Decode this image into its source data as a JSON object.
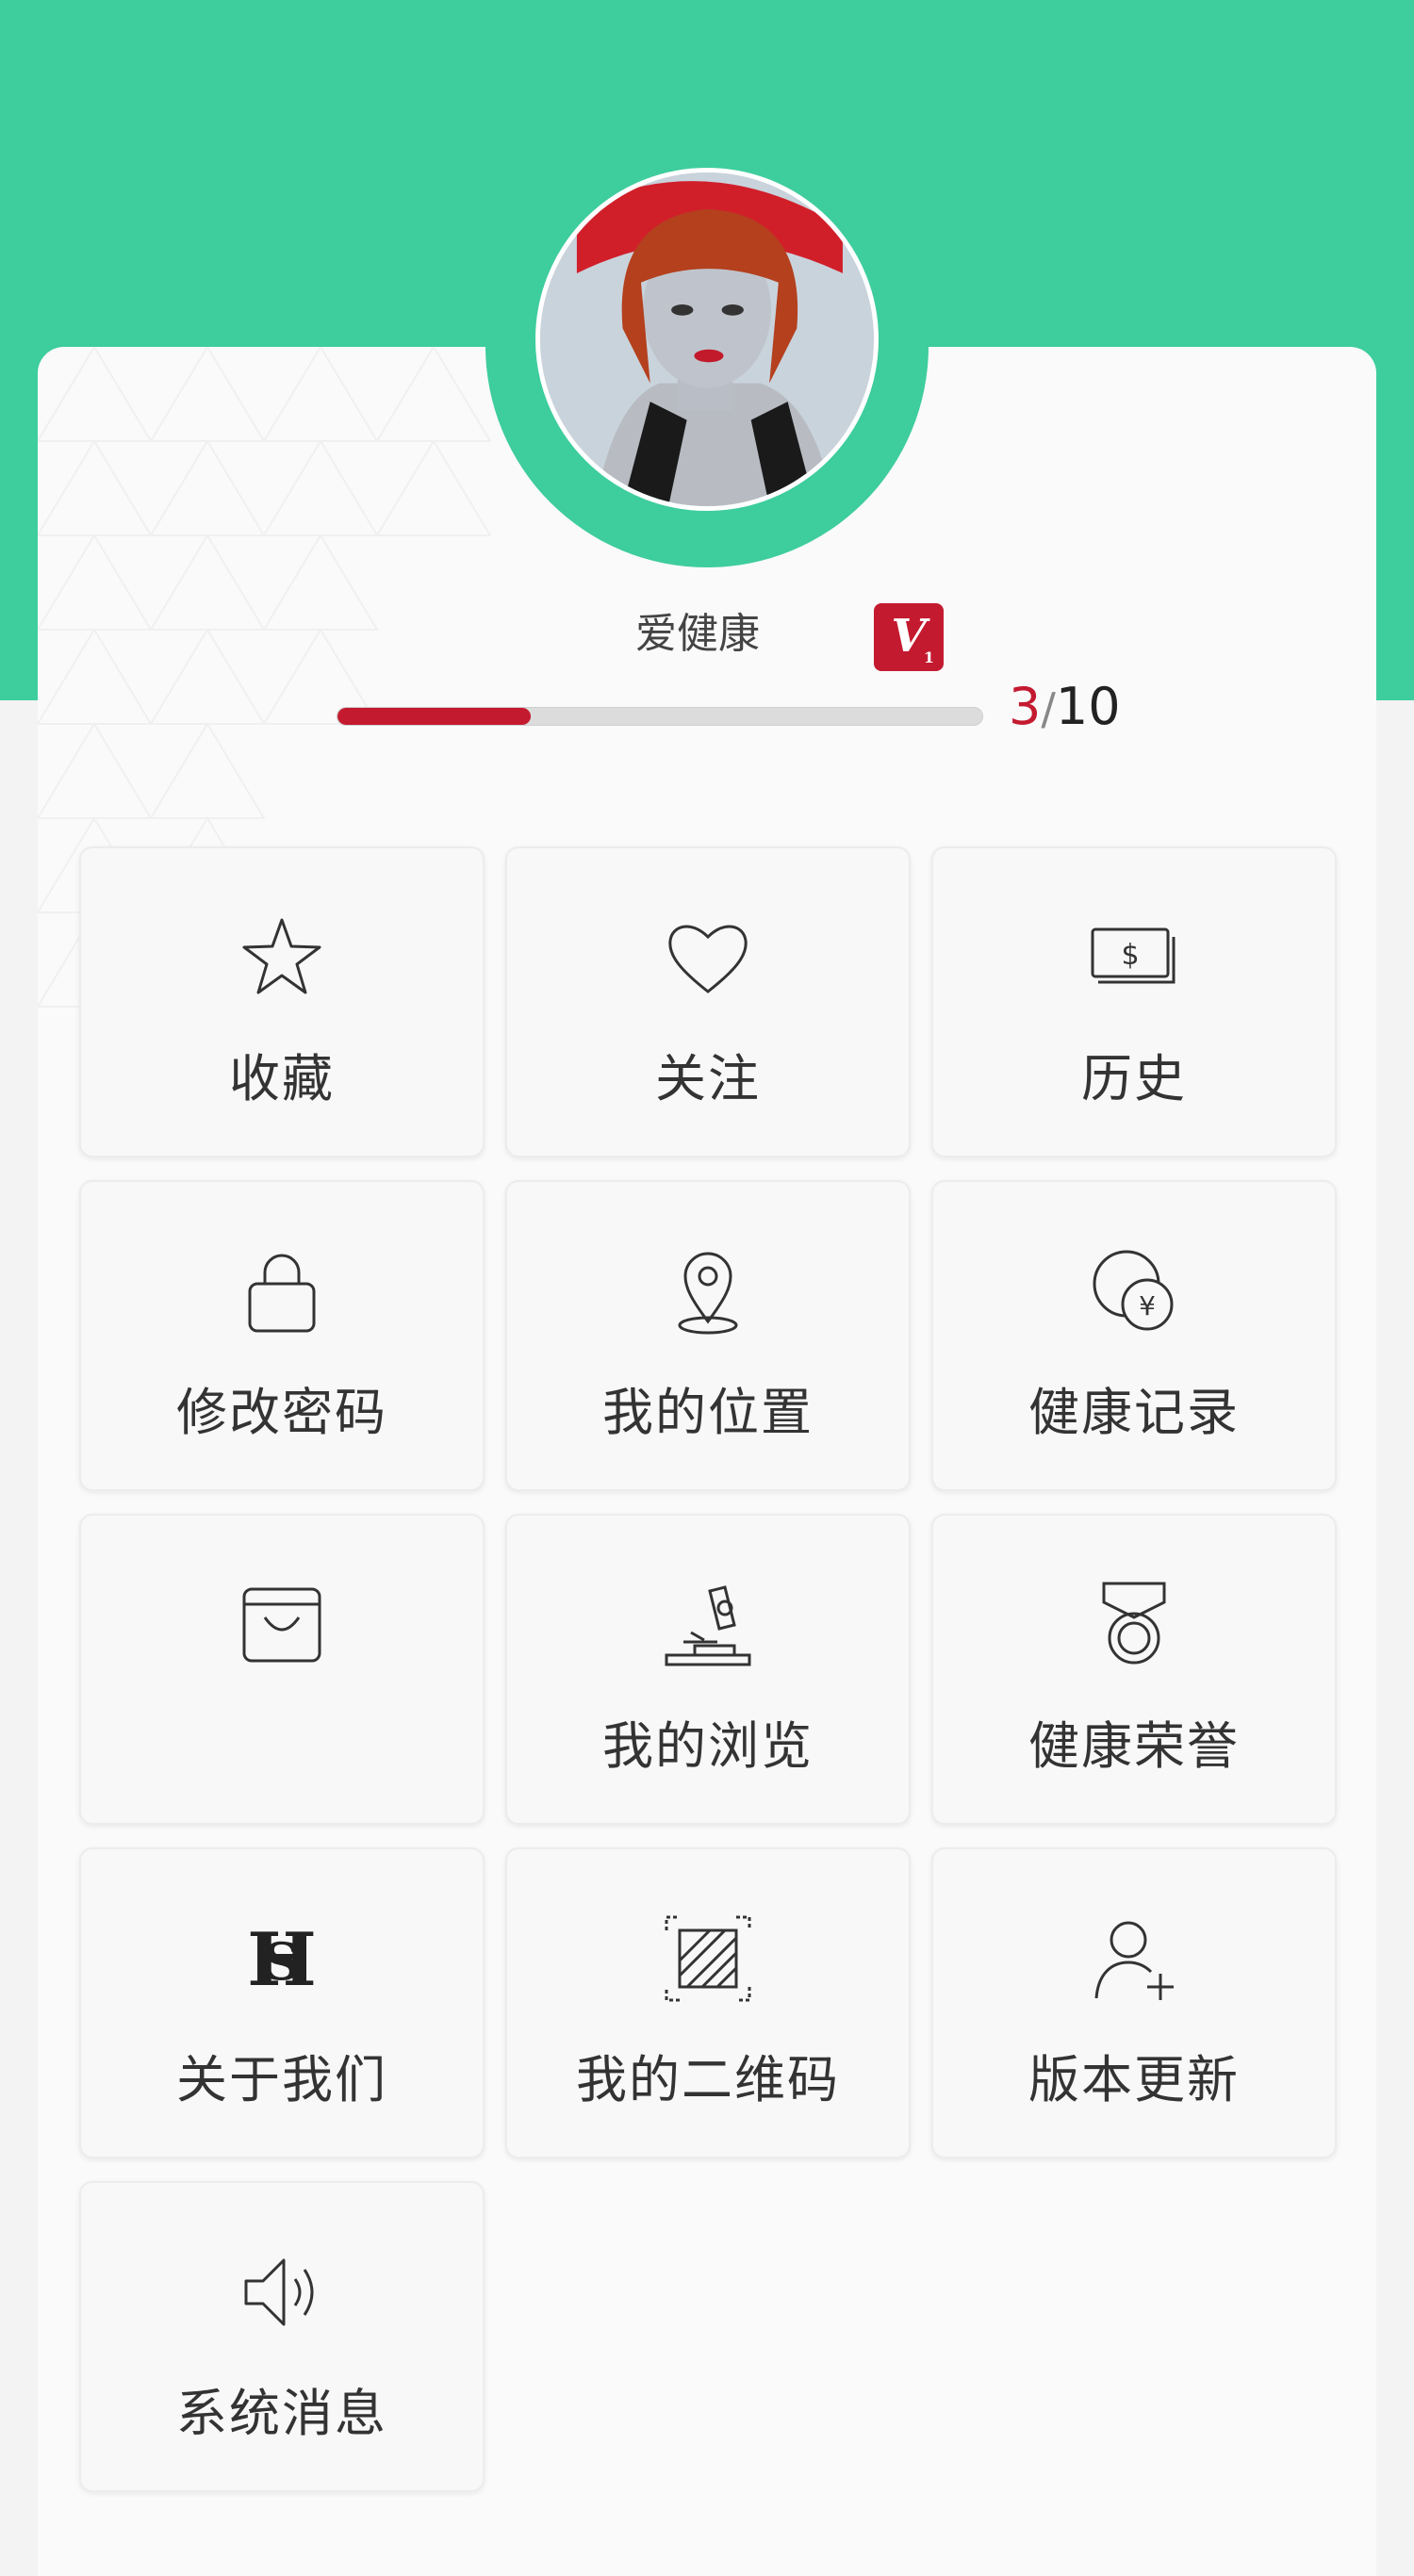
{
  "profile": {
    "username": "爱健康",
    "vip_badge": "V",
    "vip_level": "1",
    "progress_current": "3",
    "progress_separator": "/",
    "progress_total": "10",
    "progress_fraction": 0.3
  },
  "colors": {
    "header_green": "#3ecd9d",
    "accent_red": "#c41a30"
  },
  "menu": [
    {
      "label": "收藏",
      "icon": "star-icon"
    },
    {
      "label": "关注",
      "icon": "heart-icon"
    },
    {
      "label": "历史",
      "icon": "money-icon"
    },
    {
      "label": "修改密码",
      "icon": "lock-icon"
    },
    {
      "label": "我的位置",
      "icon": "location-pin-icon"
    },
    {
      "label": "健康记录",
      "icon": "yuan-coin-icon"
    },
    {
      "label": "",
      "icon": "shopping-bag-icon"
    },
    {
      "label": "我的浏览",
      "icon": "microscope-icon"
    },
    {
      "label": "健康荣誉",
      "icon": "medal-icon"
    },
    {
      "label": "关于我们",
      "icon": "logo-icon"
    },
    {
      "label": "我的二维码",
      "icon": "qr-code-icon"
    },
    {
      "label": "版本更新",
      "icon": "add-user-icon"
    },
    {
      "label": "系统消息",
      "icon": "speaker-icon"
    }
  ]
}
